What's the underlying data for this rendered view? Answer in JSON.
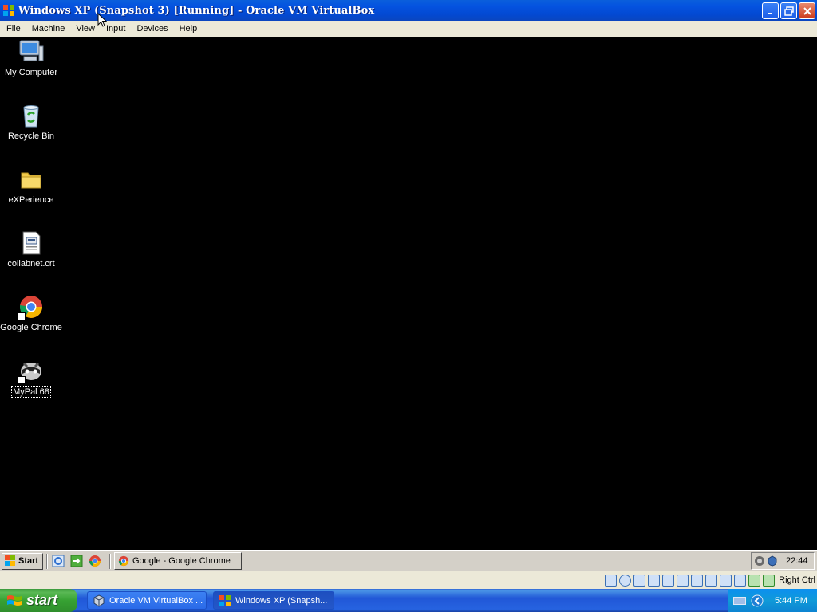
{
  "window": {
    "title": "Windows XP (Snapshot 3) [Running] - Oracle VM VirtualBox"
  },
  "menu": [
    "File",
    "Machine",
    "View",
    "Input",
    "Devices",
    "Help"
  ],
  "desktop_icons": [
    {
      "label": "My Computer",
      "icon": "my-computer-icon"
    },
    {
      "label": "Recycle Bin",
      "icon": "recycle-bin-icon"
    },
    {
      "label": "eXPerience",
      "icon": "folder-icon"
    },
    {
      "label": "collabnet.crt",
      "icon": "certificate-file-icon"
    },
    {
      "label": "Google Chrome",
      "icon": "chrome-icon",
      "shortcut": true
    },
    {
      "label": "MyPal 68",
      "icon": "mypal-icon",
      "shortcut": true,
      "focused": true
    }
  ],
  "guest_taskbar": {
    "start_label": "Start",
    "quick_launch": [
      "ie-icon",
      "show-desktop-icon",
      "chrome-icon"
    ],
    "tasks": [
      {
        "label": "Google - Google Chrome",
        "icon": "chrome-icon"
      }
    ],
    "tray_icons": [
      "network-icon",
      "security-icon"
    ],
    "clock": "22:44"
  },
  "vbox_status": {
    "indicators": [
      "hard-disk-icon",
      "optical-drive-icon",
      "audio-icon",
      "network-icon",
      "usb-icon",
      "shared-folder-icon",
      "display-icon",
      "video-capture-icon",
      "recording-icon",
      "cpu-icon",
      "mouse-integration-icon",
      "keyboard-capture-icon"
    ],
    "host_key": "Right Ctrl"
  },
  "host_taskbar": {
    "start_label": "start",
    "tasks": [
      {
        "label": "Oracle VM VirtualBox ...",
        "icon": "virtualbox-icon",
        "active": false
      },
      {
        "label": "Windows XP (Snapsh...",
        "icon": "vm-window-icon",
        "active": true
      }
    ],
    "clock": "5:44 PM"
  },
  "colors": {
    "titlebar_blue": "#0453e0",
    "menu_gray": "#ece9d8",
    "desktop_bg": "#000000",
    "start_green": "#37a233",
    "tray_blue": "#109ad8"
  }
}
